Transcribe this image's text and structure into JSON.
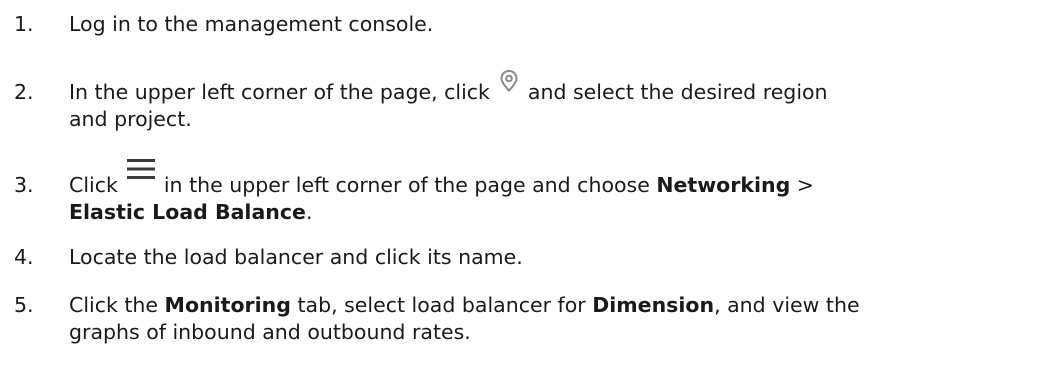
{
  "steps": [
    {
      "number": "1.",
      "text": "Log in to the management console."
    },
    {
      "number": "2.",
      "text_before": "In the upper left corner of the page, click",
      "icon": "location-pin-icon",
      "text_after": "and select the desired region",
      "text_line2": "and project."
    },
    {
      "number": "3.",
      "text_before": "Click",
      "icon": "hamburger-menu-icon",
      "text_middle": "in the upper left corner of the page and choose",
      "bold1": "Networking",
      "sep": " >",
      "bold2": "Elastic Load Balance",
      "end": "."
    },
    {
      "number": "4.",
      "text": "Locate the load balancer and click its name."
    },
    {
      "number": "5.",
      "text_before": "Click the",
      "bold1": "Monitoring",
      "text_middle": "tab, select load balancer for",
      "bold2": "Dimension",
      "text_after": ", and view the",
      "text_line2": "graphs of inbound and outbound rates."
    }
  ],
  "colors": {
    "text": "#1a1a1a",
    "pin_icon": "#8a8a8a",
    "menu_icon": "#3a3a3a"
  }
}
